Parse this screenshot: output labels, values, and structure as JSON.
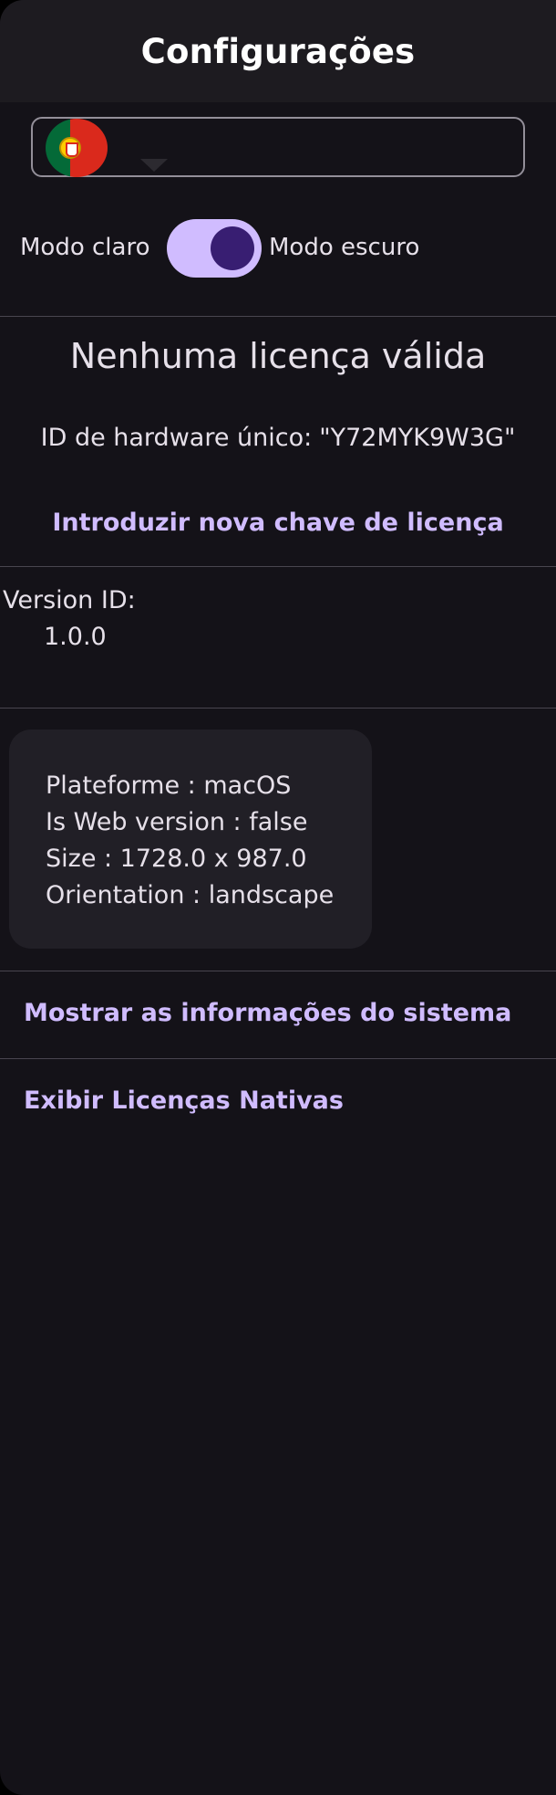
{
  "header": {
    "title": "Configurações"
  },
  "language": {
    "selected_flag_icon": "portugal-flag-icon",
    "dropdown_icon": "caret-down-icon"
  },
  "theme": {
    "light_label": "Modo claro",
    "dark_label": "Modo escuro",
    "dark_mode_enabled": true
  },
  "license": {
    "status": "Nenhuma licença válida",
    "hardware_id_label": "ID de hardware único:",
    "hardware_id_value": "\"Y72MYK9W3G\"",
    "enter_key_link": "Introduzir nova chave de licença"
  },
  "version": {
    "label": "Version ID:",
    "value": "1.0.0"
  },
  "system_info": {
    "platform": "Plateforme : macOS",
    "web_version": "Is Web version : false",
    "size": "Size : 1728.0 x 987.0",
    "orientation": "Orientation : landscape"
  },
  "links": {
    "show_system_info": "Mostrar as informações do sistema",
    "native_licenses": "Exibir Licenças Nativas"
  },
  "colors": {
    "background": "#141218",
    "accent": "#d0bcff",
    "toggle_thumb": "#381e72",
    "divider": "#49454f"
  }
}
